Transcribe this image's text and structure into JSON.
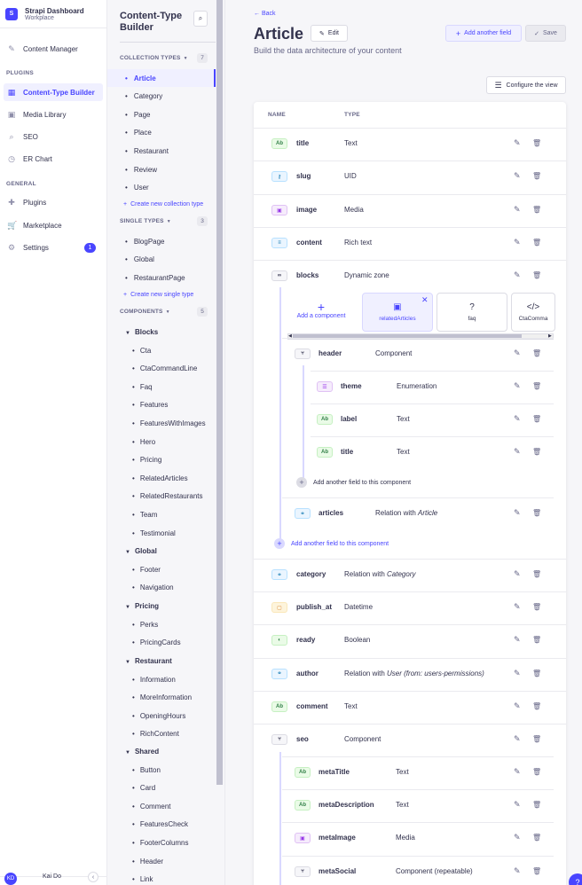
{
  "brand": {
    "logo": "S",
    "title": "Strapi Dashboard",
    "subtitle": "Workplace"
  },
  "mainnav": {
    "content_manager": "Content Manager",
    "plugins_section": "PLUGINS",
    "content_type_builder": "Content-Type Builder",
    "media_library": "Media Library",
    "seo": "SEO",
    "er_chart": "ER Chart",
    "general_section": "GENERAL",
    "plugins": "Plugins",
    "marketplace": "Marketplace",
    "settings": "Settings",
    "settings_badge": "1"
  },
  "user": {
    "initials": "KD",
    "name": "Kai Do"
  },
  "subnav": {
    "title": "Content-Type Builder",
    "collection_types": {
      "label": "COLLECTION TYPES",
      "count": "7",
      "items": [
        "Article",
        "Category",
        "Page",
        "Place",
        "Restaurant",
        "Review",
        "User"
      ],
      "create": "Create new collection type"
    },
    "single_types": {
      "label": "SINGLE TYPES",
      "count": "3",
      "items": [
        "BlogPage",
        "Global",
        "RestaurantPage"
      ],
      "create": "Create new single type"
    },
    "components": {
      "label": "COMPONENTS",
      "count": "5",
      "groups": [
        {
          "name": "Blocks",
          "items": [
            "Cta",
            "CtaCommandLine",
            "Faq",
            "Features",
            "FeaturesWithImages",
            "Hero",
            "Pricing",
            "RelatedArticles",
            "RelatedRestaurants",
            "Team",
            "Testimonial"
          ]
        },
        {
          "name": "Global",
          "items": [
            "Footer",
            "Navigation"
          ]
        },
        {
          "name": "Pricing",
          "items": [
            "Perks",
            "PricingCards"
          ]
        },
        {
          "name": "Restaurant",
          "items": [
            "Information",
            "MoreInformation",
            "OpeningHours",
            "RichContent"
          ]
        },
        {
          "name": "Shared",
          "items": [
            "Button",
            "Card",
            "Comment",
            "FeaturesCheck",
            "FooterColumns",
            "Header",
            "Link"
          ]
        }
      ]
    }
  },
  "header": {
    "back": "Back",
    "title": "Article",
    "edit": "Edit",
    "subtitle": "Build the data architecture of your content",
    "add_field": "Add another field",
    "save": "Save",
    "configure": "Configure the view"
  },
  "table": {
    "col_name": "NAME",
    "col_type": "TYPE",
    "fields": [
      {
        "icon": "Ab",
        "name": "title",
        "type": "Text"
      },
      {
        "icon": "uid-icon",
        "name": "slug",
        "type": "UID"
      },
      {
        "icon": "media-icon",
        "name": "image",
        "type": "Media"
      },
      {
        "icon": "richtext-icon",
        "name": "content",
        "type": "Rich text"
      },
      {
        "icon": "dynamiczone-icon",
        "name": "blocks",
        "type": "Dynamic zone"
      }
    ],
    "dynamic_zone": {
      "add_component": "Add a component",
      "components": [
        "relatedArticles",
        "faq",
        "CtaComma"
      ],
      "header": {
        "name": "header",
        "type": "Component"
      },
      "header_fields": [
        {
          "icon": "enum-icon",
          "name": "theme",
          "type": "Enumeration"
        },
        {
          "icon": "Ab",
          "name": "label",
          "type": "Text"
        },
        {
          "icon": "Ab",
          "name": "title",
          "type": "Text"
        }
      ],
      "add_inner": "Add another field to this component",
      "articles": {
        "name": "articles",
        "type_prefix": "Relation with ",
        "type_target": "Article"
      },
      "add_outer": "Add another field to this component"
    },
    "fields_after": [
      {
        "icon": "relation-icon",
        "name": "category",
        "type_prefix": "Relation with ",
        "type_target": "Category"
      },
      {
        "icon": "date-icon",
        "name": "publish_at",
        "type": "Datetime"
      },
      {
        "icon": "boolean-icon",
        "name": "ready",
        "type": "Boolean"
      },
      {
        "icon": "relation-icon",
        "name": "author",
        "type_prefix": "Relation with ",
        "type_target": "User (from: users-permissions)"
      },
      {
        "icon": "Ab",
        "name": "comment",
        "type": "Text"
      },
      {
        "icon": "component-icon",
        "name": "seo",
        "type": "Component"
      }
    ],
    "seo_fields": [
      {
        "icon": "Ab",
        "name": "metaTitle",
        "type": "Text"
      },
      {
        "icon": "Ab",
        "name": "metaDescription",
        "type": "Text"
      },
      {
        "icon": "media-icon",
        "name": "metaImage",
        "type": "Media"
      },
      {
        "icon": "component-icon",
        "name": "metaSocial",
        "type": "Component (repeatable)"
      }
    ]
  },
  "colors": {
    "primary": "#4945ff",
    "text": "#32324d",
    "muted": "#666687"
  }
}
